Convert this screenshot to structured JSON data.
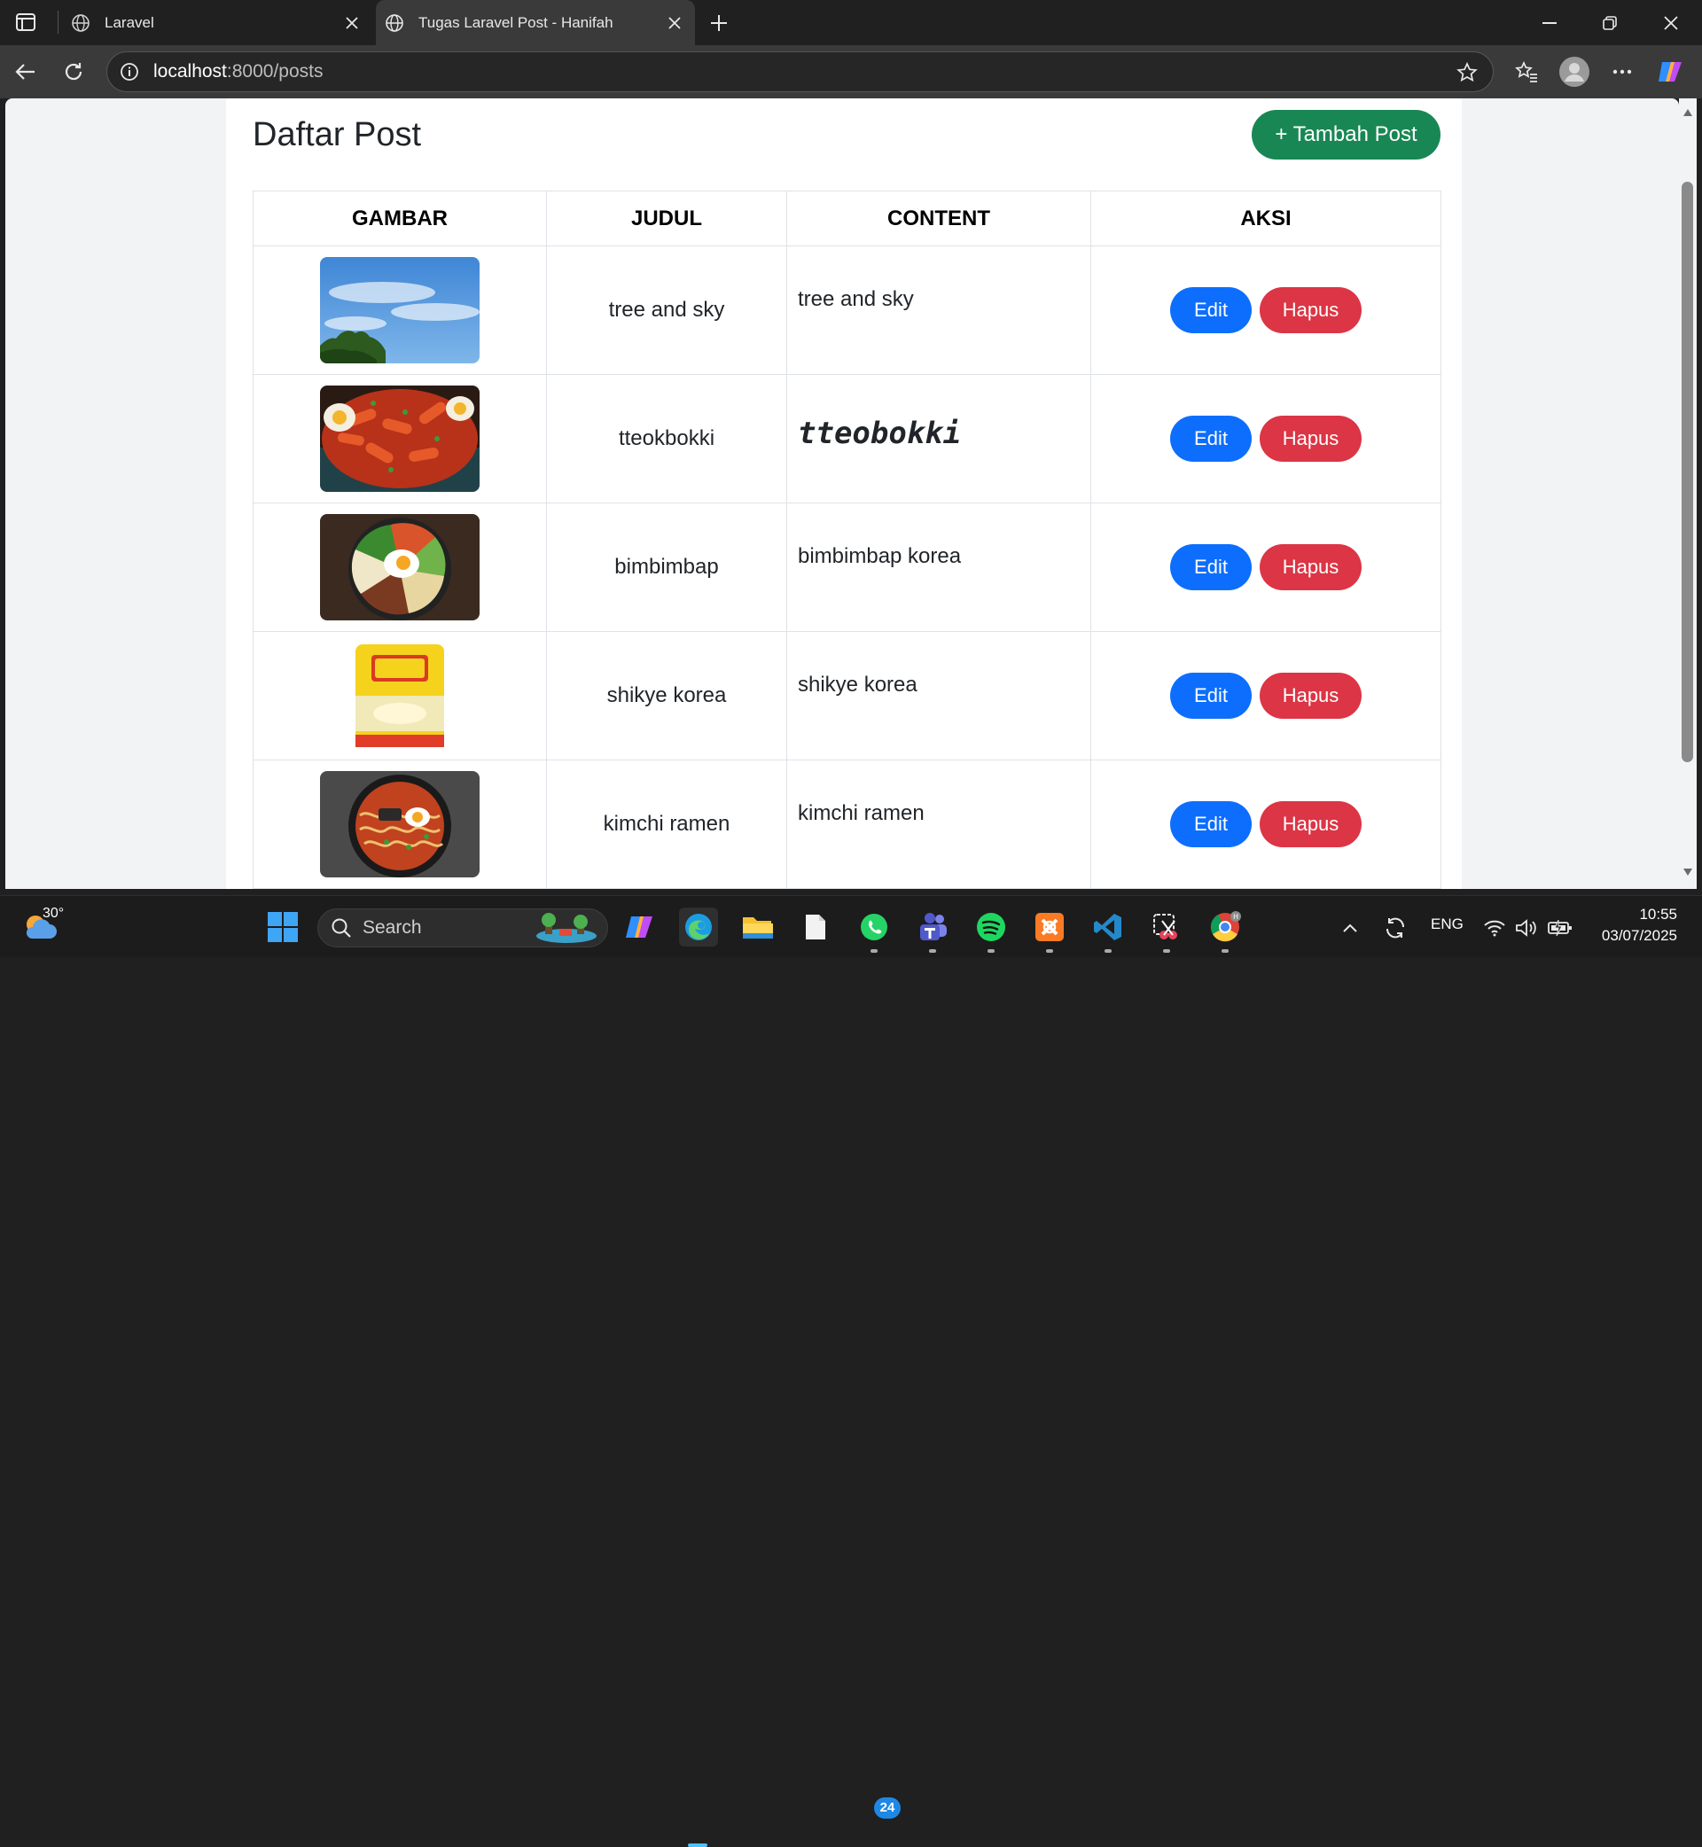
{
  "browser": {
    "tabs": [
      {
        "title": "Laravel",
        "active": false
      },
      {
        "title": "Tugas Laravel Post - Hanifah",
        "active": true
      }
    ],
    "address": {
      "host": "localhost",
      "path": ":8000/posts"
    },
    "icons": {
      "tab_actions": "tab-actions-icon",
      "back": "back-arrow-icon",
      "reload": "reload-icon",
      "info": "info-icon",
      "star": "star-icon",
      "favorites": "favorites-icon",
      "profile": "profile-icon",
      "menu": "more-icon",
      "copilot": "copilot-icon"
    }
  },
  "page": {
    "title": "Daftar Post",
    "add_button": "+ Tambah Post",
    "columns": [
      "GAMBAR",
      "JUDUL",
      "CONTENT",
      "AKSI"
    ],
    "edit_label": "Edit",
    "delete_label": "Hapus",
    "posts": [
      {
        "image": "tree-sky-image",
        "title": "tree and sky",
        "content": "tree and sky",
        "content_style": "plain"
      },
      {
        "image": "tteokbokki-image",
        "title": "tteokbokki",
        "content": "tteobokki",
        "content_style": "code"
      },
      {
        "image": "bibimbap-image",
        "title": "bimbimbap",
        "content": "bimbimbap korea",
        "content_style": "plain"
      },
      {
        "image": "shikye-drink-image",
        "title": "shikye korea",
        "content": "shikye korea",
        "content_style": "plain"
      },
      {
        "image": "kimchi-ramen-image",
        "title": "kimchi ramen",
        "content": "kimchi ramen",
        "content_style": "plain"
      }
    ],
    "colors": {
      "success": "#198754",
      "primary": "#0d6efd",
      "danger": "#dc3545"
    }
  },
  "taskbar": {
    "weather_temp": "30°",
    "search_label": "Search",
    "whatsapp_badge": "24",
    "language": "ENG",
    "time": "10:55",
    "date": "03/07/2025"
  }
}
